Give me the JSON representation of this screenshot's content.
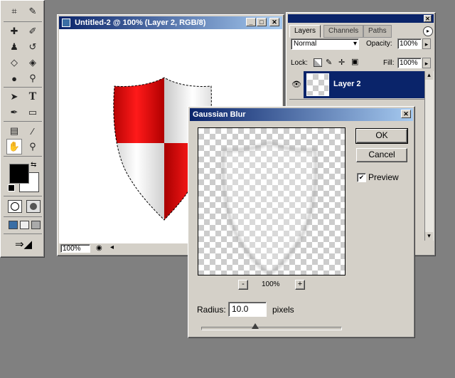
{
  "document": {
    "title": "Untitled-2 @ 100% (Layer 2, RGB/8)",
    "zoom": "100%"
  },
  "layers_panel": {
    "tabs": [
      "Layers",
      "Channels",
      "Paths"
    ],
    "blend_mode": "Normal",
    "opacity_label": "Opacity:",
    "opacity_value": "100%",
    "lock_label": "Lock:",
    "fill_label": "Fill:",
    "fill_value": "100%",
    "layer_name": "Layer 2"
  },
  "dialog": {
    "title": "Gaussian Blur",
    "ok_label": "OK",
    "cancel_label": "Cancel",
    "preview_label": "Preview",
    "preview_checked": true,
    "zoom_value": "100%",
    "zoom_minus": "-",
    "zoom_plus": "+",
    "radius_label": "Radius:",
    "radius_value": "10.0",
    "radius_unit": "pixels",
    "radius_slider_level": 0.39
  },
  "icons": {
    "close": "✕",
    "minimize": "_",
    "maximize": "□",
    "arrow_right": "▸",
    "arrow_down": "▾",
    "arrow_up": "▴",
    "check": "✔"
  },
  "colors": {
    "title_active": "#0a246a",
    "title_fade": "#a6caf0",
    "shield_red": "#e60000",
    "chrome": "#d4d0c8",
    "workspace": "#808080"
  }
}
